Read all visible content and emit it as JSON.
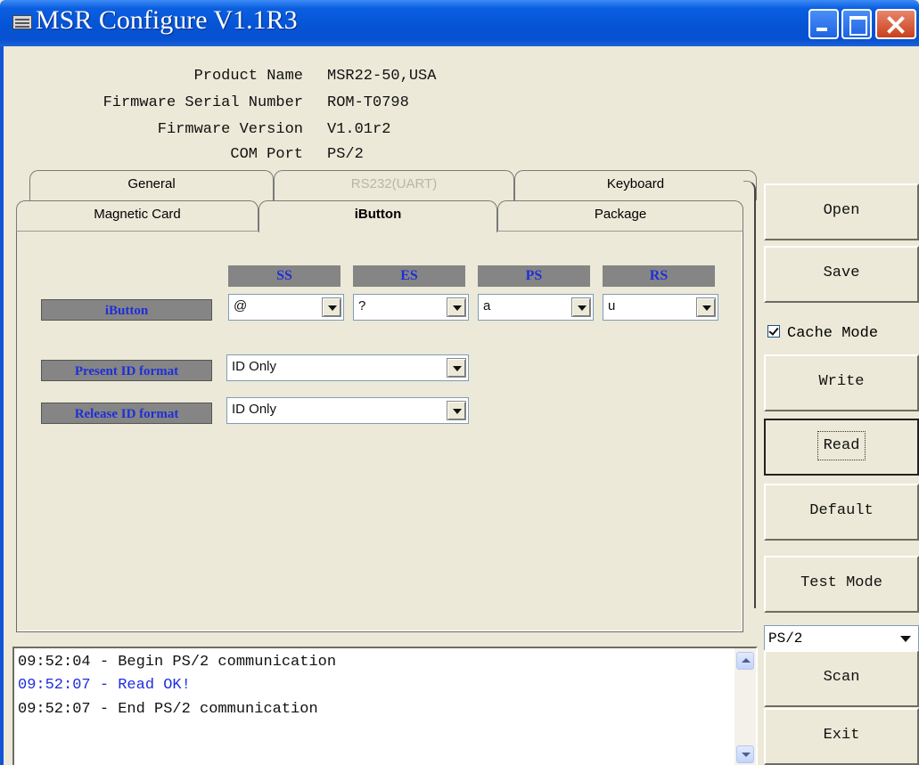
{
  "window": {
    "title": "MSR Configure V1.1R3"
  },
  "info": {
    "product_name_label": "Product Name",
    "product_name": "MSR22-50,USA",
    "serial_label": "Firmware Serial Number",
    "serial": "ROM-T0798",
    "version_label": "Firmware Version",
    "version": "V1.01r2",
    "com_label": "COM Port",
    "com": "PS/2"
  },
  "tabs": {
    "general": "General",
    "rs232": "RS232(UART)",
    "keyboard": "Keyboard",
    "magnetic": "Magnetic Card",
    "ibutton": "iButton",
    "package": "Package"
  },
  "ibutton_panel": {
    "headers": {
      "ss": "SS",
      "es": "ES",
      "ps": "PS",
      "rs": "RS"
    },
    "row_label": "iButton",
    "values": {
      "ss": "@",
      "es": "?",
      "ps": "a",
      "rs": "u"
    },
    "present_label": "Present ID format",
    "present_value": "ID Only",
    "release_label": "Release ID format",
    "release_value": "ID Only"
  },
  "buttons": {
    "open": "Open",
    "save": "Save",
    "cache_mode": "Cache Mode",
    "write": "Write",
    "read": "Read",
    "default": "Default",
    "test_mode": "Test Mode",
    "port_select": "PS/2",
    "scan": "Scan",
    "exit": "Exit"
  },
  "log": [
    "09:52:04 - Begin PS/2 communication",
    "09:52:07 - Read OK!",
    "09:52:07 - End PS/2 communication"
  ],
  "colors": {
    "title_bar": "#0554d6",
    "header_bg": "#858585",
    "header_text": "#1d2fd8",
    "log_ok": "#1e2de0"
  }
}
